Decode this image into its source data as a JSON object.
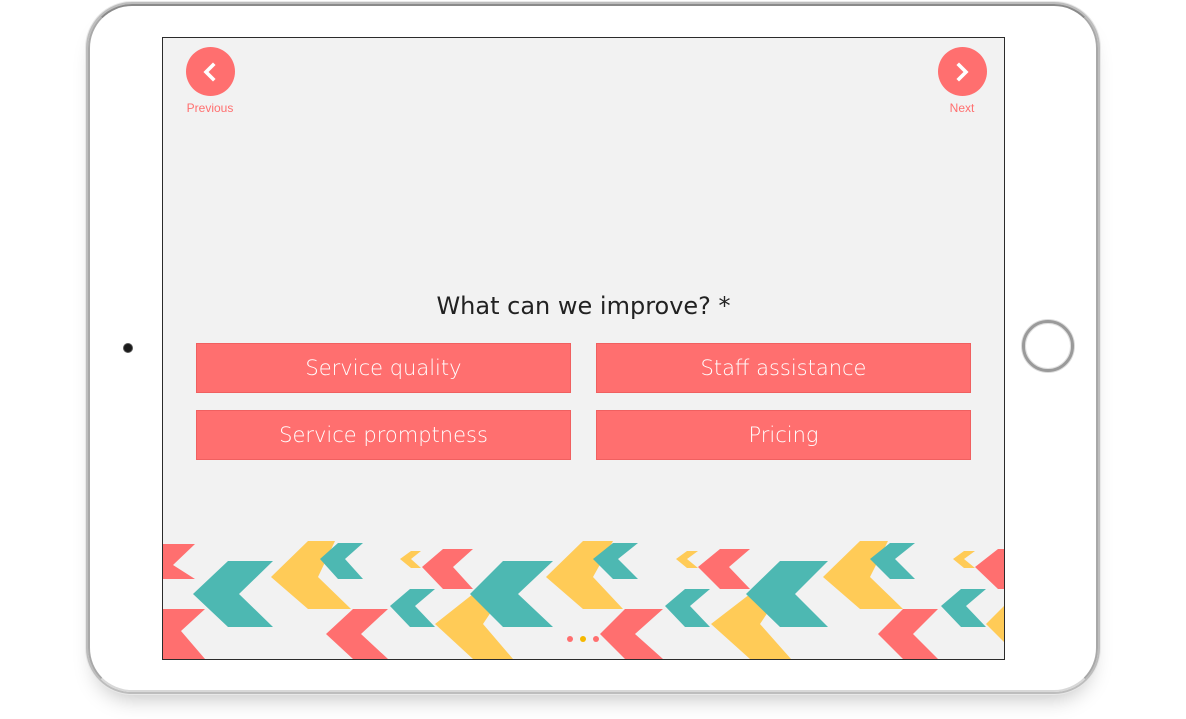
{
  "nav": {
    "previous_label": "Previous",
    "next_label": "Next",
    "previous_icon": "chevron-left-icon",
    "next_icon": "chevron-right-icon"
  },
  "question": {
    "text": "What can we improve? *",
    "required": true
  },
  "options": [
    {
      "label": "Service quality"
    },
    {
      "label": "Staff assistance"
    },
    {
      "label": "Service promptness"
    },
    {
      "label": "Pricing"
    }
  ],
  "pagination": {
    "total": 3,
    "active_index": 1
  },
  "colors": {
    "accent": "#ff6f6f",
    "teal": "#4db8b2",
    "yellow": "#ffcb57",
    "background": "#f2f2f2",
    "active_dot": "#f5b800"
  }
}
